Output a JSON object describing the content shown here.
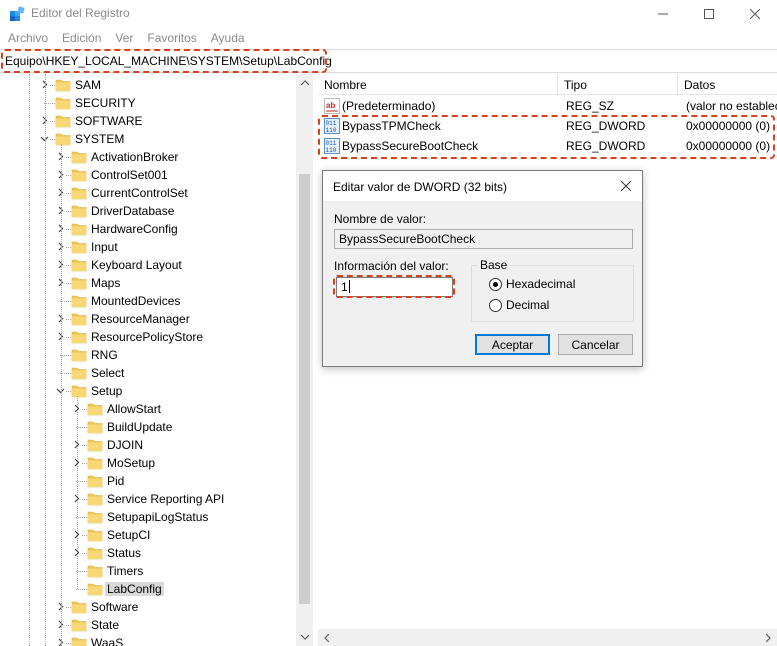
{
  "window": {
    "title": "Editor del Registro"
  },
  "menu": [
    "Archivo",
    "Edición",
    "Ver",
    "Favoritos",
    "Ayuda"
  ],
  "address": "Equipo\\HKEY_LOCAL_MACHINE\\SYSTEM\\Setup\\LabConfig",
  "tree": [
    {
      "label": "SAM",
      "level": 2,
      "expandable": true,
      "expanded": false
    },
    {
      "label": "SECURITY",
      "level": 2,
      "expandable": false
    },
    {
      "label": "SOFTWARE",
      "level": 2,
      "expandable": true,
      "expanded": false
    },
    {
      "label": "SYSTEM",
      "level": 2,
      "expandable": true,
      "expanded": true
    },
    {
      "label": "ActivationBroker",
      "level": 3,
      "expandable": true,
      "expanded": false
    },
    {
      "label": "ControlSet001",
      "level": 3,
      "expandable": true,
      "expanded": false
    },
    {
      "label": "CurrentControlSet",
      "level": 3,
      "expandable": true,
      "expanded": false
    },
    {
      "label": "DriverDatabase",
      "level": 3,
      "expandable": true,
      "expanded": false
    },
    {
      "label": "HardwareConfig",
      "level": 3,
      "expandable": true,
      "expanded": false
    },
    {
      "label": "Input",
      "level": 3,
      "expandable": true,
      "expanded": false
    },
    {
      "label": "Keyboard Layout",
      "level": 3,
      "expandable": true,
      "expanded": false
    },
    {
      "label": "Maps",
      "level": 3,
      "expandable": true,
      "expanded": false
    },
    {
      "label": "MountedDevices",
      "level": 3,
      "expandable": false
    },
    {
      "label": "ResourceManager",
      "level": 3,
      "expandable": true,
      "expanded": false
    },
    {
      "label": "ResourcePolicyStore",
      "level": 3,
      "expandable": true,
      "expanded": false
    },
    {
      "label": "RNG",
      "level": 3,
      "expandable": false
    },
    {
      "label": "Select",
      "level": 3,
      "expandable": false
    },
    {
      "label": "Setup",
      "level": 3,
      "expandable": true,
      "expanded": true
    },
    {
      "label": "AllowStart",
      "level": 4,
      "expandable": true,
      "expanded": false
    },
    {
      "label": "BuildUpdate",
      "level": 4,
      "expandable": false
    },
    {
      "label": "DJOIN",
      "level": 4,
      "expandable": true,
      "expanded": false
    },
    {
      "label": "MoSetup",
      "level": 4,
      "expandable": true,
      "expanded": false
    },
    {
      "label": "Pid",
      "level": 4,
      "expandable": false
    },
    {
      "label": "Service Reporting API",
      "level": 4,
      "expandable": true,
      "expanded": false
    },
    {
      "label": "SetupapiLogStatus",
      "level": 4,
      "expandable": false
    },
    {
      "label": "SetupCI",
      "level": 4,
      "expandable": true,
      "expanded": false
    },
    {
      "label": "Status",
      "level": 4,
      "expandable": true,
      "expanded": false
    },
    {
      "label": "Timers",
      "level": 4,
      "expandable": false
    },
    {
      "label": "LabConfig",
      "level": 4,
      "expandable": false,
      "selected": true
    },
    {
      "label": "Software",
      "level": 3,
      "expandable": true,
      "expanded": false
    },
    {
      "label": "State",
      "level": 3,
      "expandable": true,
      "expanded": false
    },
    {
      "label": "WaaS",
      "level": 3,
      "expandable": true,
      "expanded": false
    }
  ],
  "list": {
    "columns": [
      "Nombre",
      "Tipo",
      "Datos"
    ],
    "rows": [
      {
        "name": "(Predeterminado)",
        "type": "REG_SZ",
        "data": "(valor no establecido)",
        "icon": "string-value-icon"
      },
      {
        "name": "BypassTPMCheck",
        "type": "REG_DWORD",
        "data": "0x00000000 (0)",
        "icon": "binary-value-icon"
      },
      {
        "name": "BypassSecureBootCheck",
        "type": "REG_DWORD",
        "data": "0x00000000 (0)",
        "icon": "binary-value-icon"
      }
    ]
  },
  "dialog": {
    "title": "Editar valor de DWORD (32 bits)",
    "name_label": "Nombre de valor:",
    "name_value": "BypassSecureBootCheck",
    "data_label": "Información del valor:",
    "data_value": "1",
    "base_label": "Base",
    "base_options": [
      "Hexadecimal",
      "Decimal"
    ],
    "base_selected": "Hexadecimal",
    "ok_label": "Aceptar",
    "cancel_label": "Cancelar"
  },
  "colors": {
    "highlight": "#d9411e",
    "selection": "#d9d9d9",
    "folder": "#f3c74f",
    "accent": "#0078d7"
  }
}
